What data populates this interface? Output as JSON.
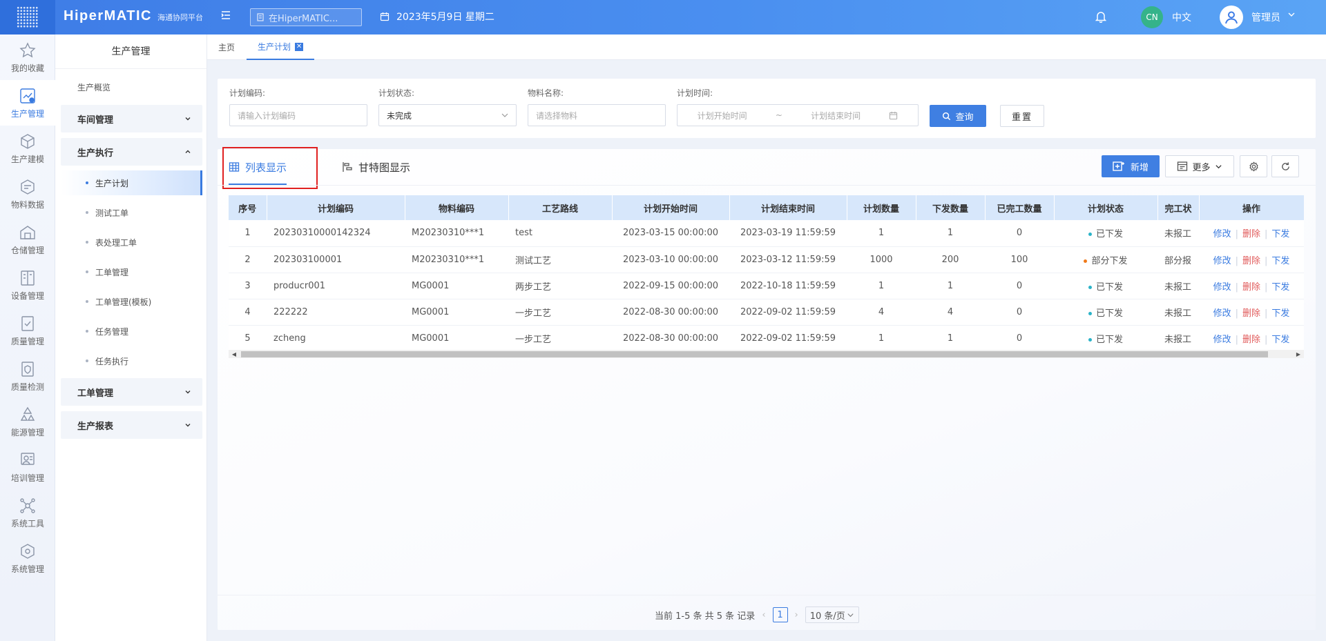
{
  "header": {
    "logo": "HiperMATIC",
    "logo_sub": "海通协同平台",
    "search_placeholder": "在HiperMATIC...",
    "date": "2023年5月9日 星期二",
    "lang_badge": "CN",
    "lang": "中文",
    "user": "管理员",
    "accent": "#3e7ce6"
  },
  "iconbar": [
    {
      "label": "我的收藏",
      "icon": "star-icon"
    },
    {
      "label": "生产管理",
      "icon": "production-icon"
    },
    {
      "label": "生产建模",
      "icon": "cube-icon"
    },
    {
      "label": "物料数据",
      "icon": "material-icon"
    },
    {
      "label": "仓储管理",
      "icon": "warehouse-icon"
    },
    {
      "label": "设备管理",
      "icon": "device-icon"
    },
    {
      "label": "质量管理",
      "icon": "quality-icon"
    },
    {
      "label": "质量检测",
      "icon": "inspection-icon"
    },
    {
      "label": "能源管理",
      "icon": "recycle-icon"
    },
    {
      "label": "培训管理",
      "icon": "training-icon"
    },
    {
      "label": "系统工具",
      "icon": "network-icon"
    },
    {
      "label": "系统管理",
      "icon": "settings-cube-icon"
    }
  ],
  "menu": {
    "title": "生产管理",
    "overview": "生产概览",
    "groups": [
      "车间管理",
      "生产执行",
      "工单管理",
      "生产报表"
    ],
    "exec_items": [
      "生产计划",
      "测试工单",
      "表处理工单",
      "工单管理",
      "工单管理(模板)",
      "任务管理",
      "任务执行"
    ]
  },
  "tabs": [
    "主页",
    "生产计划"
  ],
  "filter": {
    "plan_code_label": "计划编码:",
    "plan_code_placeholder": "请输入计划编码",
    "status_label": "计划状态:",
    "status_value": "未完成",
    "material_label": "物料名称:",
    "material_placeholder": "请选择物料",
    "time_label": "计划时间:",
    "start_placeholder": "计划开始时间",
    "range_sep": "~",
    "end_placeholder": "计划结束时间",
    "query": "查询",
    "reset": "重置"
  },
  "views": {
    "list": "列表显示",
    "gantt": "甘特图显示"
  },
  "toolbar": {
    "add": "新增",
    "more": "更多"
  },
  "table": {
    "columns": [
      "序号",
      "计划编码",
      "物料编码",
      "工艺路线",
      "计划开始时间",
      "计划结束时间",
      "计划数量",
      "下发数量",
      "已完工数量",
      "计划状态",
      "完工状",
      "操作"
    ],
    "rows": [
      {
        "no": "1",
        "code": "20230310000142324",
        "material": "M20230310***1",
        "route": "test",
        "start": "2023-03-15 00:00:00",
        "end": "2023-03-19 11:59:59",
        "plan_qty": "1",
        "issue_qty": "1",
        "done_qty": "0",
        "status": "已下发",
        "status_color": "#2bb3c8",
        "finish": "未报工"
      },
      {
        "no": "2",
        "code": "202303100001",
        "material": "M20230310***1",
        "route": "测试工艺",
        "start": "2023-03-10 00:00:00",
        "end": "2023-03-12 11:59:59",
        "plan_qty": "1000",
        "issue_qty": "200",
        "done_qty": "100",
        "status": "部分下发",
        "status_color": "#f07a1a",
        "finish": "部分报"
      },
      {
        "no": "3",
        "code": "producr001",
        "material": "MG0001",
        "route": "两步工艺",
        "start": "2022-09-15 00:00:00",
        "end": "2022-10-18 11:59:59",
        "plan_qty": "1",
        "issue_qty": "1",
        "done_qty": "0",
        "status": "已下发",
        "status_color": "#2bb3c8",
        "finish": "未报工"
      },
      {
        "no": "4",
        "code": "222222",
        "material": "MG0001",
        "route": "一步工艺",
        "start": "2022-08-30 00:00:00",
        "end": "2022-09-02 11:59:59",
        "plan_qty": "4",
        "issue_qty": "4",
        "done_qty": "0",
        "status": "已下发",
        "status_color": "#2bb3c8",
        "finish": "未报工"
      },
      {
        "no": "5",
        "code": "zcheng",
        "material": "MG0001",
        "route": "一步工艺",
        "start": "2022-08-30 00:00:00",
        "end": "2022-09-02 11:59:59",
        "plan_qty": "1",
        "issue_qty": "1",
        "done_qty": "0",
        "status": "已下发",
        "status_color": "#2bb3c8",
        "finish": "未报工"
      }
    ],
    "actions": {
      "edit": "修改",
      "delete": "删除",
      "issue": "下发"
    }
  },
  "pager": {
    "summary": "当前 1-5 条 共 5 条 记录",
    "page": "1",
    "size": "10 条/页"
  }
}
